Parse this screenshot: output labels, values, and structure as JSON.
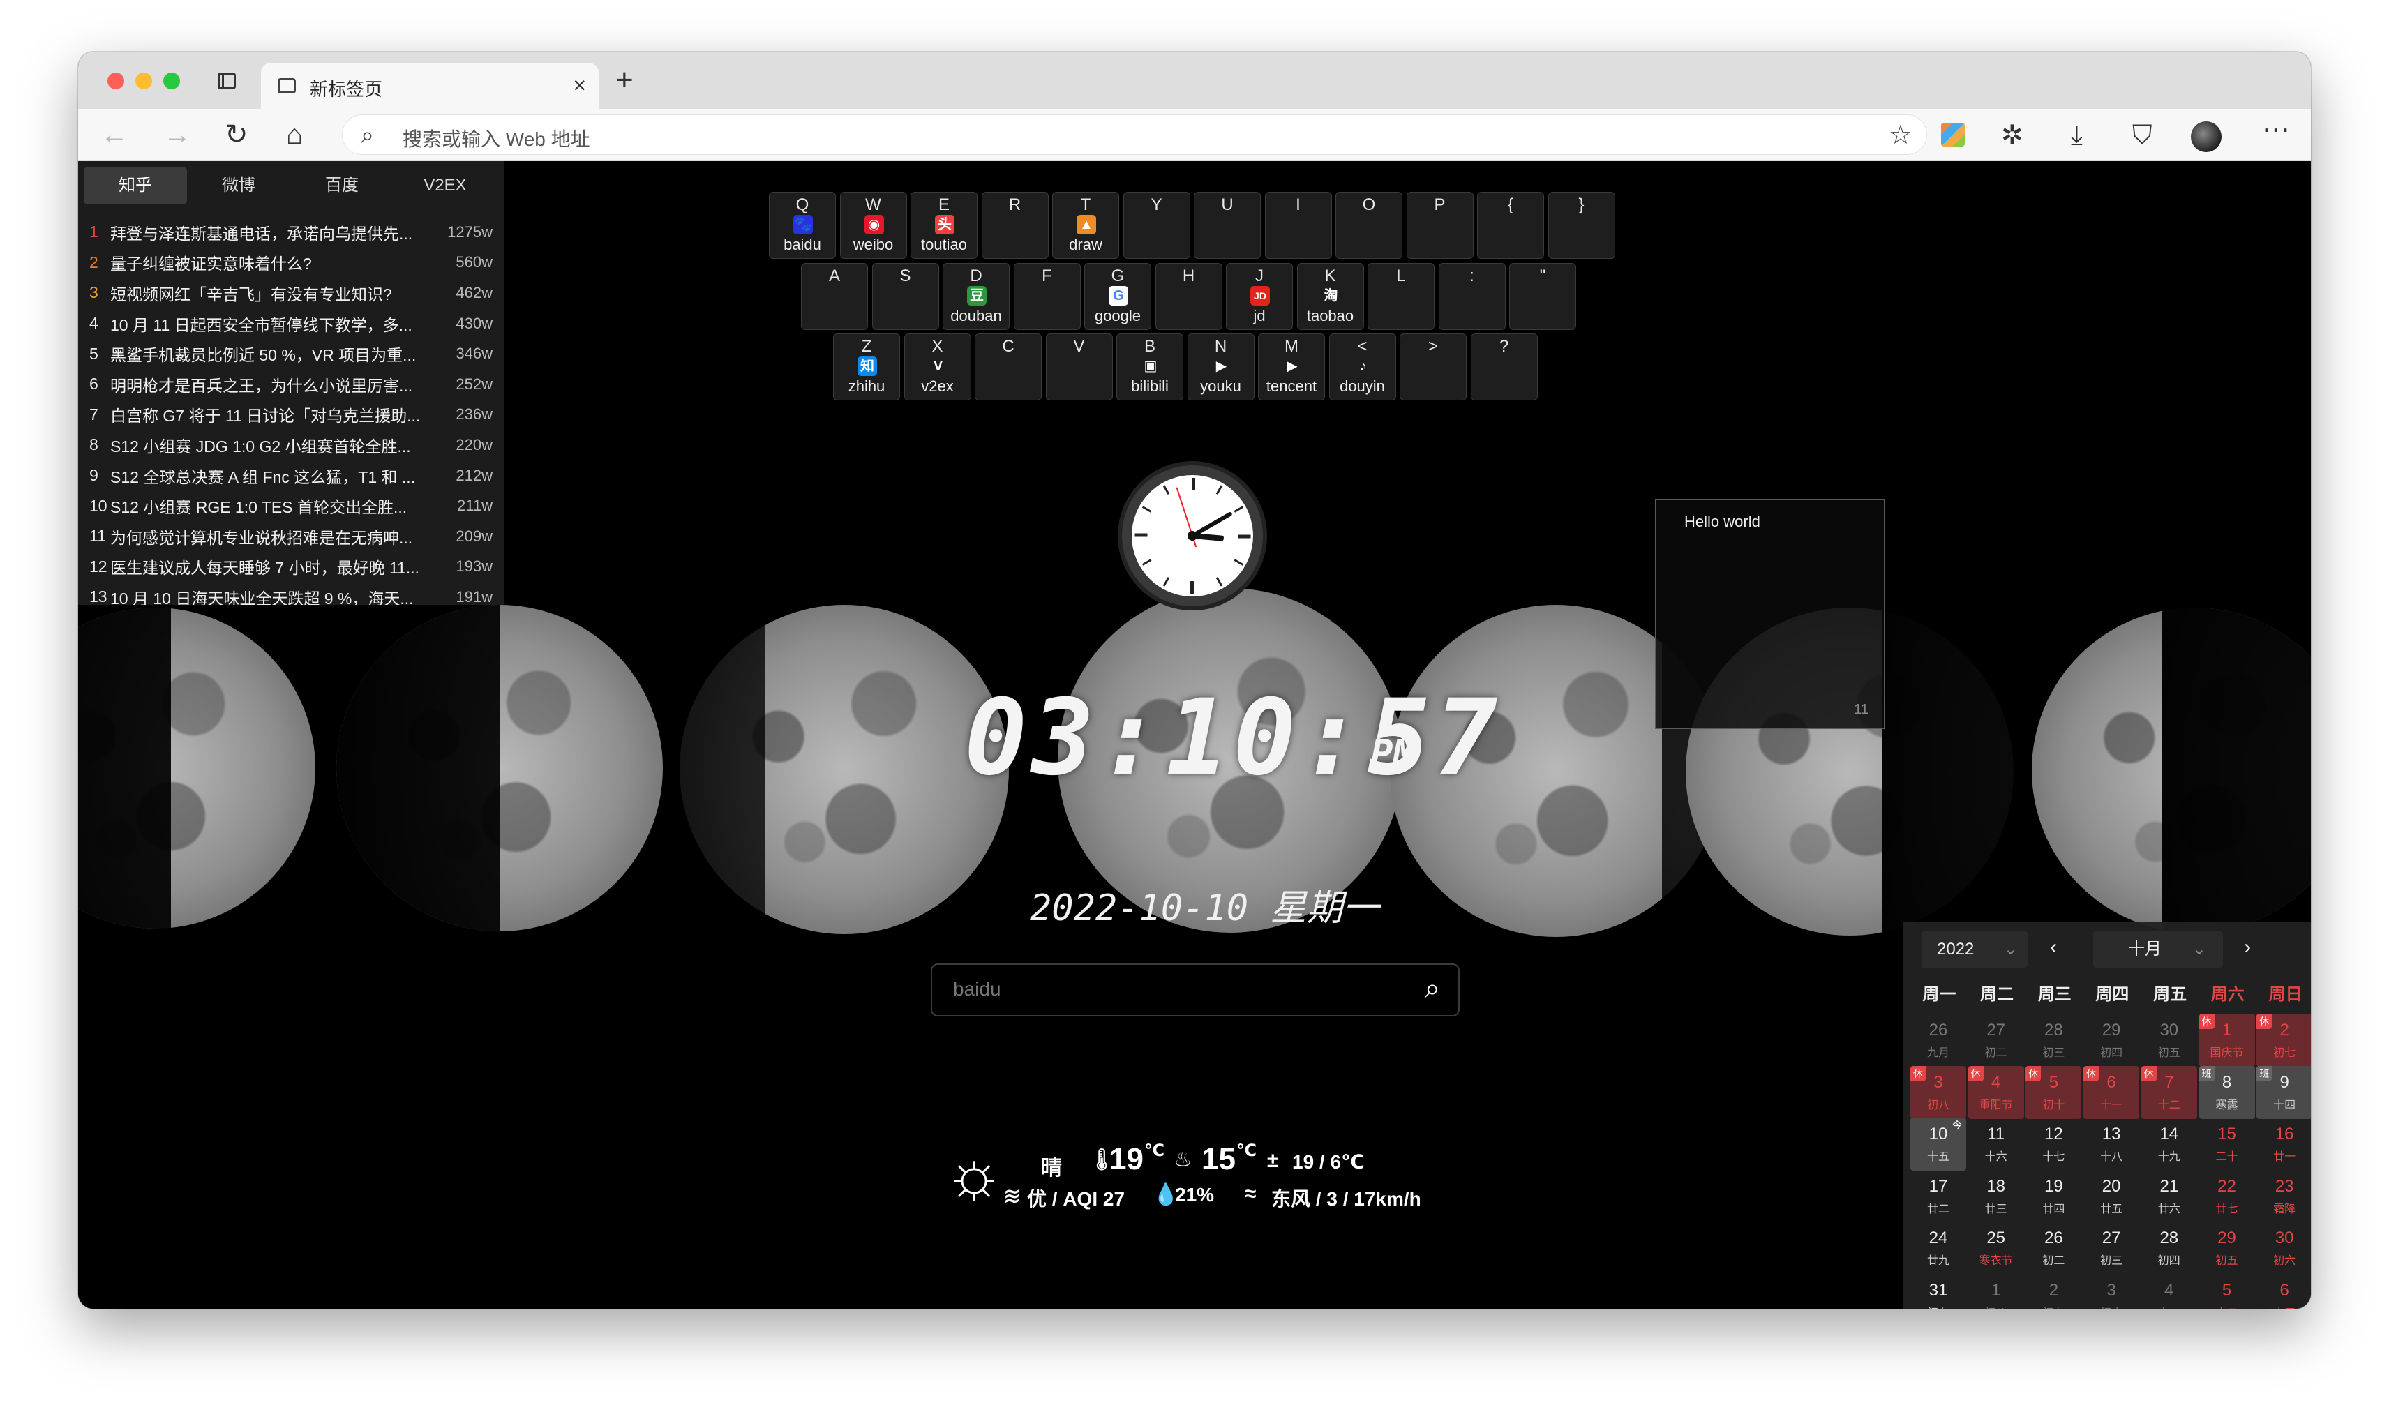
{
  "browser": {
    "tab_title": "新标签页",
    "tab_close": "×",
    "new_tab": "+",
    "address_placeholder": "搜索或输入 Web 地址"
  },
  "hot": {
    "tabs": [
      "知乎",
      "微博",
      "百度",
      "V2EX"
    ],
    "active_tab": "知乎",
    "items": [
      {
        "rank": "1",
        "title": "拜登与泽连斯基通电话，承诺向乌提供先...",
        "heat": "1275w",
        "color": "#e04646"
      },
      {
        "rank": "2",
        "title": "量子纠缠被证实意味着什么?",
        "heat": "560w",
        "color": "#f07b2b"
      },
      {
        "rank": "3",
        "title": "短视频网红「辛吉飞」有没有专业知识?",
        "heat": "462w",
        "color": "#f0a82b"
      },
      {
        "rank": "4",
        "title": "10 月 11 日起西安全市暂停线下教学，多...",
        "heat": "430w",
        "color": "#eeeeee"
      },
      {
        "rank": "5",
        "title": "黑鲨手机裁员比例近 50 %，VR 项目为重...",
        "heat": "346w",
        "color": "#eeeeee"
      },
      {
        "rank": "6",
        "title": "明明枪才是百兵之王，为什么小说里厉害...",
        "heat": "252w",
        "color": "#eeeeee"
      },
      {
        "rank": "7",
        "title": "白宫称 G7 将于 11 日讨论「对乌克兰援助...",
        "heat": "236w",
        "color": "#eeeeee"
      },
      {
        "rank": "8",
        "title": "S12 小组赛 JDG 1:0 G2 小组赛首轮全胜...",
        "heat": "220w",
        "color": "#eeeeee"
      },
      {
        "rank": "9",
        "title": "S12 全球总决赛 A 组 Fnc 这么猛，T1 和 ...",
        "heat": "212w",
        "color": "#eeeeee"
      },
      {
        "rank": "10",
        "title": "S12 小组赛 RGE 1:0 TES 首轮交出全胜...",
        "heat": "211w",
        "color": "#eeeeee"
      },
      {
        "rank": "11",
        "title": "为何感觉计算机专业说秋招难是在无病呻...",
        "heat": "209w",
        "color": "#eeeeee"
      },
      {
        "rank": "12",
        "title": "医生建议成人每天睡够 7 小时，最好晚 11...",
        "heat": "193w",
        "color": "#eeeeee"
      },
      {
        "rank": "13",
        "title": "10 月 10 日海天味业全天跌超 9 %，海天...",
        "heat": "191w",
        "color": "#eeeeee"
      }
    ]
  },
  "keyboard": {
    "rows": [
      [
        {
          "k": "Q",
          "label": "baidu",
          "icon": "baidu-icon",
          "color": "#2932e1",
          "glyph": "🐾"
        },
        {
          "k": "W",
          "label": "weibo",
          "icon": "weibo-icon",
          "color": "#e6162d",
          "glyph": "◉"
        },
        {
          "k": "E",
          "label": "toutiao",
          "icon": "toutiao-icon",
          "color": "#f04142",
          "glyph": "头"
        },
        {
          "k": "R",
          "label": "",
          "icon": "",
          "color": "",
          "glyph": ""
        },
        {
          "k": "T",
          "label": "draw",
          "icon": "draw-icon",
          "color": "#f08a24",
          "glyph": "▲"
        },
        {
          "k": "Y",
          "label": "",
          "icon": "",
          "color": "",
          "glyph": ""
        },
        {
          "k": "U",
          "label": "",
          "icon": "",
          "color": "",
          "glyph": ""
        },
        {
          "k": "I",
          "label": "",
          "icon": "",
          "color": "",
          "glyph": ""
        },
        {
          "k": "O",
          "label": "",
          "icon": "",
          "color": "",
          "glyph": ""
        },
        {
          "k": "P",
          "label": "",
          "icon": "",
          "color": "",
          "glyph": ""
        },
        {
          "k": "{",
          "label": "",
          "icon": "",
          "color": "",
          "glyph": ""
        },
        {
          "k": "}",
          "label": "",
          "icon": "",
          "color": "",
          "glyph": ""
        }
      ],
      [
        {
          "k": "A",
          "label": "",
          "icon": "",
          "color": "",
          "glyph": ""
        },
        {
          "k": "S",
          "label": "",
          "icon": "",
          "color": "",
          "glyph": ""
        },
        {
          "k": "D",
          "label": "douban",
          "icon": "douban-icon",
          "color": "#2e963d",
          "glyph": "豆"
        },
        {
          "k": "F",
          "label": "",
          "icon": "",
          "color": "",
          "glyph": ""
        },
        {
          "k": "G",
          "label": "google",
          "icon": "google-icon",
          "color": "#ffffff",
          "glyph": "G"
        },
        {
          "k": "H",
          "label": "",
          "icon": "",
          "color": "",
          "glyph": ""
        },
        {
          "k": "J",
          "label": "jd",
          "icon": "jd-icon",
          "color": "#e1251b",
          "glyph": "JD"
        },
        {
          "k": "K",
          "label": "taobao",
          "icon": "taobao-icon",
          "color": "#1e1e1e",
          "glyph": "淘"
        },
        {
          "k": "L",
          "label": "",
          "icon": "",
          "color": "",
          "glyph": ""
        },
        {
          "k": ":",
          "label": "",
          "icon": "",
          "color": "",
          "glyph": ""
        },
        {
          "k": "\"",
          "label": "",
          "icon": "",
          "color": "",
          "glyph": ""
        }
      ],
      [
        {
          "k": "Z",
          "label": "zhihu",
          "icon": "zhihu-icon",
          "color": "#0f88eb",
          "glyph": "知"
        },
        {
          "k": "X",
          "label": "v2ex",
          "icon": "v2ex-icon",
          "color": "#1e1e1e",
          "glyph": "V"
        },
        {
          "k": "C",
          "label": "",
          "icon": "",
          "color": "",
          "glyph": ""
        },
        {
          "k": "V",
          "label": "",
          "icon": "",
          "color": "",
          "glyph": ""
        },
        {
          "k": "B",
          "label": "bilibili",
          "icon": "bilibili-icon",
          "color": "#1e1e1e",
          "glyph": "▣"
        },
        {
          "k": "N",
          "label": "youku",
          "icon": "youku-icon",
          "color": "#1e1e1e",
          "glyph": "▶"
        },
        {
          "k": "M",
          "label": "tencent",
          "icon": "tencent-video-icon",
          "color": "#1e1e1e",
          "glyph": "▶"
        },
        {
          "k": "<",
          "label": "douyin",
          "icon": "douyin-icon",
          "color": "#1e1e1e",
          "glyph": "♪"
        },
        {
          "k": ">",
          "label": "",
          "icon": "",
          "color": "",
          "glyph": ""
        },
        {
          "k": "?",
          "label": "",
          "icon": "",
          "color": "",
          "glyph": ""
        }
      ]
    ]
  },
  "time": {
    "digits": "03:10:57",
    "ampm": "PM",
    "date": "2022-10-10 星期一"
  },
  "search": {
    "placeholder": "baidu"
  },
  "note": {
    "text": "Hello world",
    "count": "11"
  },
  "weather": {
    "condition": "晴",
    "temp": "19",
    "temp_unit": "℃",
    "feels": "15",
    "feels_unit": "℃",
    "range": "19 / 6℃",
    "aqi": "优 / AQI 27",
    "humidity": "21%",
    "wind": "东风 / 3 / 17km/h"
  },
  "calendar": {
    "year": "2022",
    "month": "十月",
    "weekdays": [
      "周一",
      "周二",
      "周三",
      "周四",
      "周五",
      "周六",
      "周日"
    ],
    "days": [
      {
        "d": "26",
        "l": "九月",
        "s": "other"
      },
      {
        "d": "27",
        "l": "初二",
        "s": "other"
      },
      {
        "d": "28",
        "l": "初三",
        "s": "other"
      },
      {
        "d": "29",
        "l": "初四",
        "s": "other"
      },
      {
        "d": "30",
        "l": "初五",
        "s": "other"
      },
      {
        "d": "1",
        "l": "国庆节",
        "s": "rest",
        "b": "休"
      },
      {
        "d": "2",
        "l": "初七",
        "s": "rest",
        "b": "休"
      },
      {
        "d": "3",
        "l": "初八",
        "s": "rest",
        "b": "休"
      },
      {
        "d": "4",
        "l": "重阳节",
        "s": "rest",
        "b": "休"
      },
      {
        "d": "5",
        "l": "初十",
        "s": "rest",
        "b": "休"
      },
      {
        "d": "6",
        "l": "十一",
        "s": "rest",
        "b": "休"
      },
      {
        "d": "7",
        "l": "十二",
        "s": "rest",
        "b": "休"
      },
      {
        "d": "8",
        "l": "寒露",
        "s": "work",
        "b": "班"
      },
      {
        "d": "9",
        "l": "十四",
        "s": "work",
        "b": "班"
      },
      {
        "d": "10",
        "l": "十五",
        "s": "today",
        "b": "今"
      },
      {
        "d": "11",
        "l": "十六",
        "s": ""
      },
      {
        "d": "12",
        "l": "十七",
        "s": ""
      },
      {
        "d": "13",
        "l": "十八",
        "s": ""
      },
      {
        "d": "14",
        "l": "十九",
        "s": ""
      },
      {
        "d": "15",
        "l": "二十",
        "s": "red"
      },
      {
        "d": "16",
        "l": "廿一",
        "s": "red"
      },
      {
        "d": "17",
        "l": "廿二",
        "s": ""
      },
      {
        "d": "18",
        "l": "廿三",
        "s": ""
      },
      {
        "d": "19",
        "l": "廿四",
        "s": ""
      },
      {
        "d": "20",
        "l": "廿五",
        "s": ""
      },
      {
        "d": "21",
        "l": "廿六",
        "s": ""
      },
      {
        "d": "22",
        "l": "廿七",
        "s": "red"
      },
      {
        "d": "23",
        "l": "霜降",
        "s": "red"
      },
      {
        "d": "24",
        "l": "廿九",
        "s": ""
      },
      {
        "d": "25",
        "l": "寒衣节",
        "s": "hl"
      },
      {
        "d": "26",
        "l": "初二",
        "s": ""
      },
      {
        "d": "27",
        "l": "初三",
        "s": ""
      },
      {
        "d": "28",
        "l": "初四",
        "s": ""
      },
      {
        "d": "29",
        "l": "初五",
        "s": "red"
      },
      {
        "d": "30",
        "l": "初六",
        "s": "red"
      },
      {
        "d": "31",
        "l": "初七",
        "s": ""
      },
      {
        "d": "1",
        "l": "初八",
        "s": "other"
      },
      {
        "d": "2",
        "l": "初九",
        "s": "other"
      },
      {
        "d": "3",
        "l": "初十",
        "s": "other"
      },
      {
        "d": "4",
        "l": "十一",
        "s": "other"
      },
      {
        "d": "5",
        "l": "十二",
        "s": "other red"
      },
      {
        "d": "6",
        "l": "十三",
        "s": "other red"
      }
    ]
  }
}
